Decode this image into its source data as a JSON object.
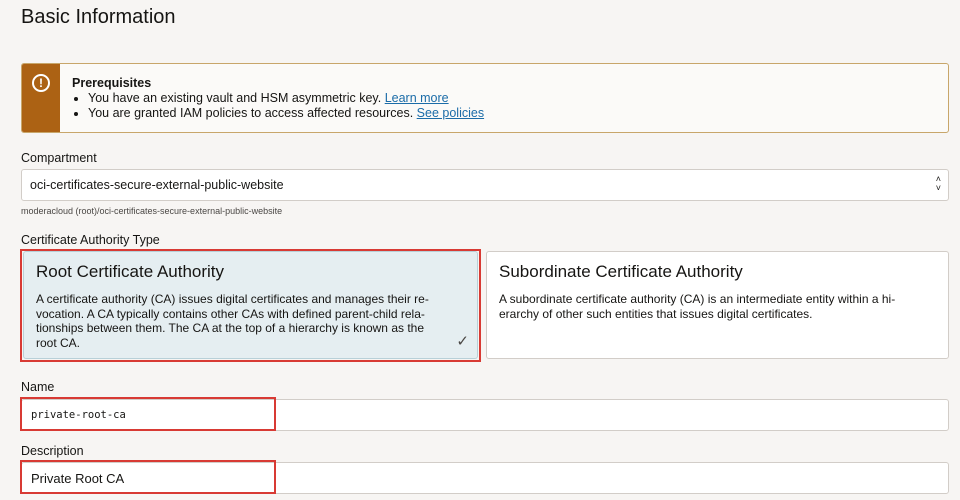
{
  "page": {
    "title": "Basic Information"
  },
  "notice": {
    "title": "Prerequisites",
    "items": [
      {
        "text": "You have an existing vault and HSM asymmetric key.",
        "link": "Learn more"
      },
      {
        "text": "You are granted IAM policies to access affected resources.",
        "link": "See policies"
      }
    ],
    "icon": "warning-icon",
    "color": "#ac6214"
  },
  "compartment": {
    "label": "Compartment",
    "value": "oci-certificates-secure-external-public-website",
    "helper": "moderacloud (root)/oci-certificates-secure-external-public-website"
  },
  "ca_type": {
    "label": "Certificate Authority Type",
    "options": [
      {
        "title": "Root Certificate Authority",
        "description": "A certificate authority (CA) issues digital certificates and manages their re-vocation. A CA typically contains other CAs with defined parent-child rela-tionships between them. The CA at the top of a hierarchy is known as the root CA.",
        "selected": true
      },
      {
        "title": "Subordinate Certificate Authority",
        "description": "A subordinate certificate authority (CA) is an intermediate entity within a hi-erarchy of other such entities that issues digital certificates.",
        "selected": false
      }
    ]
  },
  "name": {
    "label": "Name",
    "value": "private-root-ca"
  },
  "description": {
    "label": "Description",
    "value": "Private Root CA"
  },
  "colors": {
    "highlight": "#d83a34",
    "selected_bg": "#e5eef1",
    "link": "#1b6ca8"
  }
}
